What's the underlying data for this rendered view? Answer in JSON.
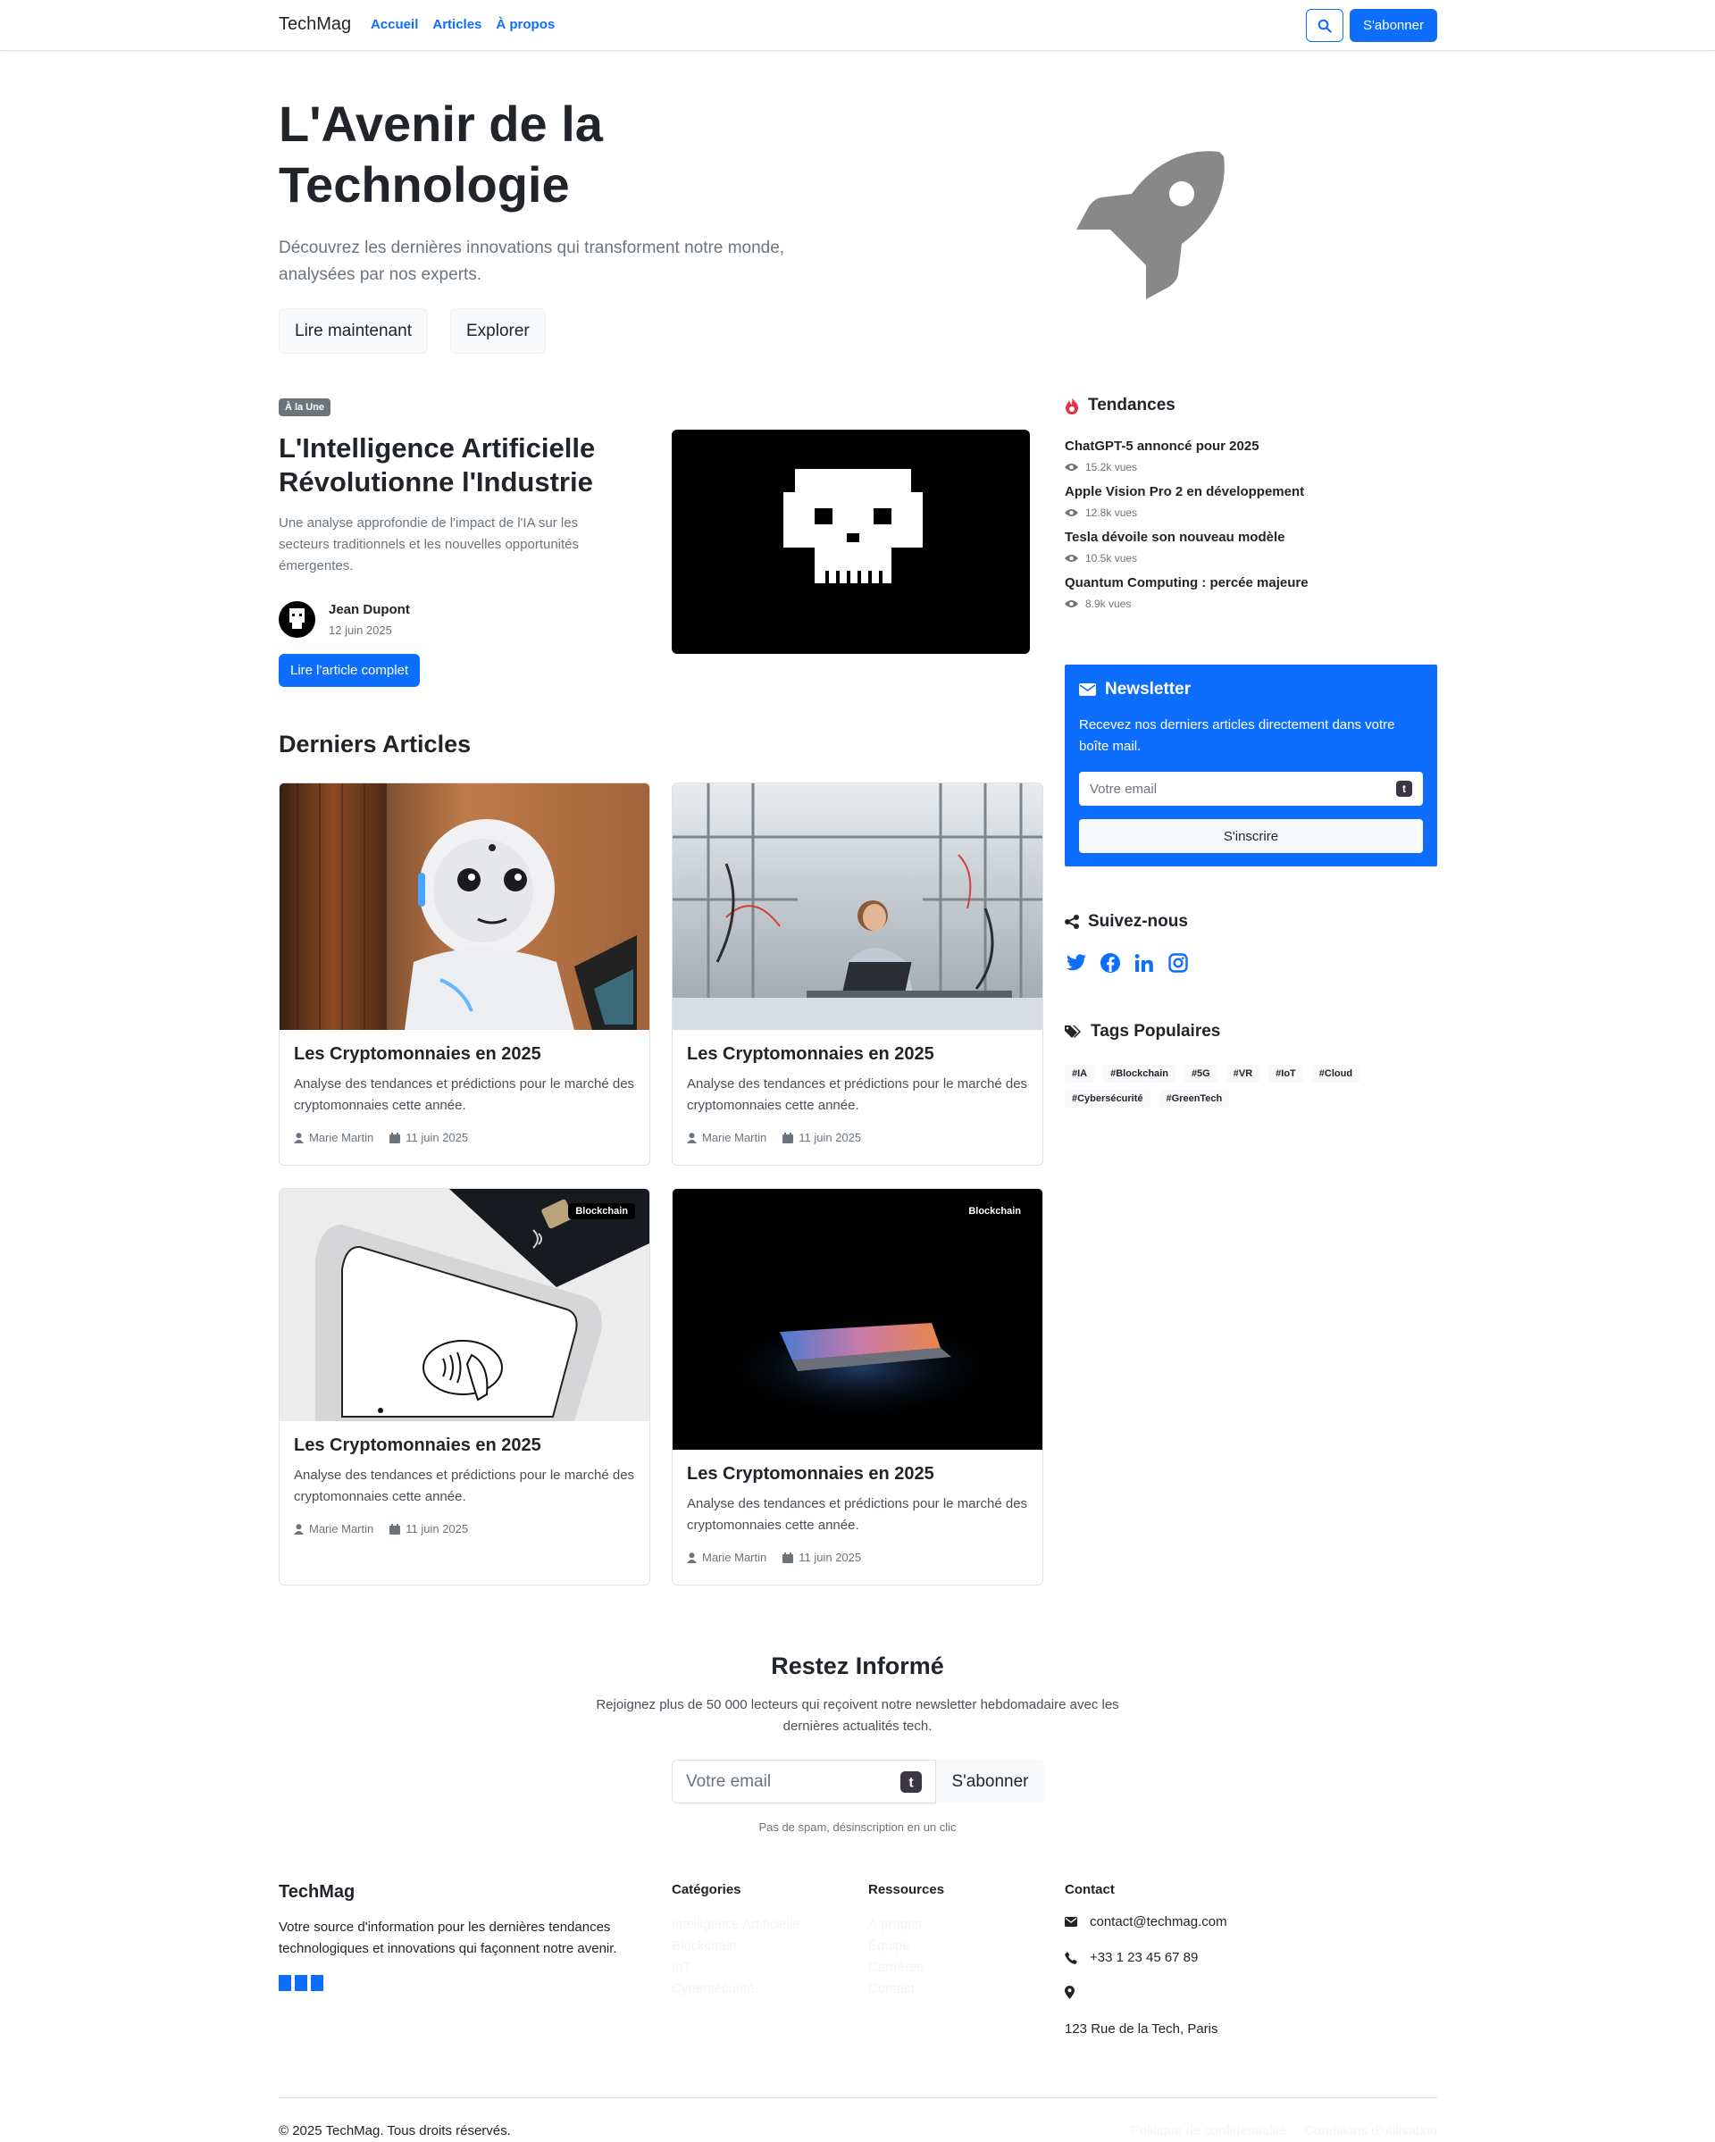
{
  "nav": {
    "brand": "TechMag",
    "links": [
      "Accueil",
      "Articles",
      "À propos"
    ],
    "subscribe": "S'abonner"
  },
  "hero": {
    "title": "L'Avenir de la Technologie",
    "lead": "Découvrez les dernières innovations qui transforment notre monde, analysées par nos experts.",
    "btn_read": "Lire maintenant",
    "btn_explore": "Explorer"
  },
  "featured": {
    "badge": "À la Une",
    "title": "L'Intelligence Artificielle Révolutionne l'Industrie",
    "desc": "Une analyse approfondie de l'impact de l'IA sur les secteurs traditionnels et les nouvelles opportunités émergentes.",
    "author": "Jean Dupont",
    "date": "12 juin 2025",
    "read_btn": "Lire l'article complet"
  },
  "articles": {
    "section_title": "Derniers Articles",
    "items": [
      {
        "title": "Les Cryptomonnaies en 2025",
        "text": "Analyse des tendances et prédictions pour le marché des cryptomonnaies cette année.",
        "author": "Marie Martin",
        "date": "11 juin 2025",
        "badge": ""
      },
      {
        "title": "Les Cryptomonnaies en 2025",
        "text": "Analyse des tendances et prédictions pour le marché des cryptomonnaies cette année.",
        "author": "Marie Martin",
        "date": "11 juin 2025",
        "badge": ""
      },
      {
        "title": "Les Cryptomonnaies en 2025",
        "text": "Analyse des tendances et prédictions pour le marché des cryptomonnaies cette année.",
        "author": "Marie Martin",
        "date": "11 juin 2025",
        "badge": "Blockchain"
      },
      {
        "title": "Les Cryptomonnaies en 2025",
        "text": "Analyse des tendances et prédictions pour le marché des cryptomonnaies cette année.",
        "author": "Marie Martin",
        "date": "11 juin 2025",
        "badge": "Blockchain"
      }
    ]
  },
  "sidebar": {
    "trends_title": "Tendances",
    "trends": [
      {
        "title": "ChatGPT-5 annoncé pour 2025",
        "views": "15.2k vues"
      },
      {
        "title": "Apple Vision Pro 2 en développement",
        "views": "12.8k vues"
      },
      {
        "title": "Tesla dévoile son nouveau modèle",
        "views": "10.5k vues"
      },
      {
        "title": "Quantum Computing : percée majeure",
        "views": "8.9k vues"
      }
    ],
    "newsletter": {
      "title": "Newsletter",
      "text": "Recevez nos derniers articles directement dans votre boîte mail.",
      "placeholder": "Votre email",
      "button": "S'inscrire"
    },
    "follow_title": "Suivez-nous",
    "social_icons": [
      "twitter-icon",
      "facebook-icon",
      "linkedin-icon",
      "instagram-icon"
    ],
    "tags_title": "Tags Populaires",
    "tags": [
      "#IA",
      "#Blockchain",
      "#5G",
      "#VR",
      "#IoT",
      "#Cloud",
      "#Cybersécurité",
      "#GreenTech"
    ]
  },
  "stay_informed": {
    "title": "Restez Informé",
    "text": "Rejoignez plus de 50 000 lecteurs qui reçoivent notre newsletter hebdomadaire avec les dernières actualités tech.",
    "placeholder": "Votre email",
    "button": "S'abonner",
    "note": "Pas de spam, désinscription en un clic"
  },
  "footer": {
    "brand": "TechMag",
    "desc": "Votre source d'information pour les dernières tendances technologiques et innovations qui façonnent notre avenir.",
    "categories_title": "Catégories",
    "categories": [
      "Intelligence Artificielle",
      "Blockchain",
      "IoT",
      "Cybersécurité"
    ],
    "resources_title": "Ressources",
    "resources": [
      "À propos",
      "Équipe",
      "Carrières",
      "Contact"
    ],
    "contact_title": "Contact",
    "email": "contact@techmag.com",
    "phone": "+33 1 23 45 67 89",
    "address": "123 Rue de la Tech, Paris",
    "copyright": "© 2025 TechMag. Tous droits réservés.",
    "bottom_links": [
      "Politique de confidentialité",
      "Conditions d'utilisation"
    ]
  },
  "colors": {
    "primary": "#0d6efd",
    "muted": "#6c757d",
    "dark": "#212529",
    "light": "#f8f9fa",
    "trend_icon": "#dc3545"
  }
}
